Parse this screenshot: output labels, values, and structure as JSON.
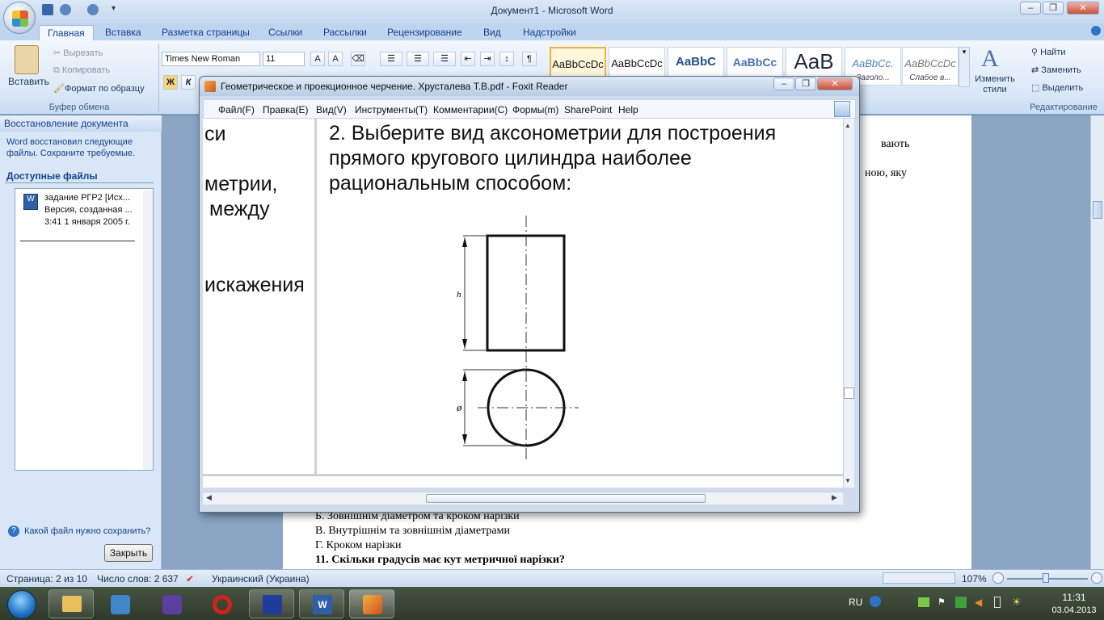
{
  "word": {
    "title": "Документ1 - Microsoft Word",
    "tabs": [
      "Главная",
      "Вставка",
      "Разметка страницы",
      "Ссылки",
      "Рассылки",
      "Рецензирование",
      "Вид",
      "Надстройки"
    ],
    "clipboard": {
      "paste": "Вставить",
      "cut": "Вырезать",
      "copy": "Копировать",
      "format_painter": "Формат по образцу",
      "group": "Буфер обмена"
    },
    "font": {
      "name": "Times New Roman",
      "size": "11",
      "bold": "Ж",
      "italic": "К"
    },
    "styles": [
      {
        "sample": "AaBbCcDc",
        "label": ""
      },
      {
        "sample": "AaBbCcDc",
        "label": ""
      },
      {
        "sample": "AaBbC",
        "label": ""
      },
      {
        "sample": "AaBbCc",
        "label": ""
      },
      {
        "sample": "AaB",
        "label": ""
      },
      {
        "sample": "AaBbCc.",
        "label": "Заголо..."
      },
      {
        "sample": "AaBbCcDc",
        "label": "Слабое в..."
      }
    ],
    "change_styles": "Изменить стили",
    "editing": {
      "find": "Найти",
      "replace": "Заменить",
      "select": "Выделить",
      "group": "Редактирование"
    },
    "recovery": {
      "title": "Восстановление документа",
      "message": "Word восстановил следующие файлы.  Сохраните требуемые.",
      "available": "Доступные файлы",
      "file_name": "задание РГР2  [Исх...",
      "file_version": "Версия, созданная ...",
      "file_time": "3:41 1 января 2005 г.",
      "help": "Какой файл нужно сохранить?",
      "close": "Закрыть"
    },
    "doc_lines": [
      "Б. Зовнішнім діаметром та кроком нарізки",
      "В. Внутрішнім та зовнішнім діаметрами",
      "Г. Кроком нарізки",
      "11. Скільки градусів має кут метричної нарізки?"
    ],
    "doc_right_1": "вають",
    "doc_right_2": "ною, яку",
    "status": {
      "page": "Страница: 2 из 10",
      "words": "Число слов: 2 637",
      "lang": "Украинский (Украина)",
      "zoom": "107%"
    }
  },
  "foxit": {
    "title": "Геометрическое и проекционное черчение. Хрусталева Т.В.pdf - Foxit Reader",
    "menu": [
      "Файл(F)",
      "Правка(E)",
      "Вид(V)",
      "Инструменты(T)",
      "Комментарии(C)",
      "Формы(m)",
      "SharePoint",
      "Help"
    ],
    "left_col": [
      "си",
      "метрии,",
      "между",
      "искажения"
    ],
    "question": [
      "2. Выберите вид аксонометрии для построения",
      "прямого кругового цилиндра наиболее",
      "рациональным способом:"
    ],
    "dim_h": "h",
    "dim_d": "ø"
  },
  "taskbar": {
    "lang": "RU",
    "time": "11:31",
    "date": "03.04.2013"
  }
}
